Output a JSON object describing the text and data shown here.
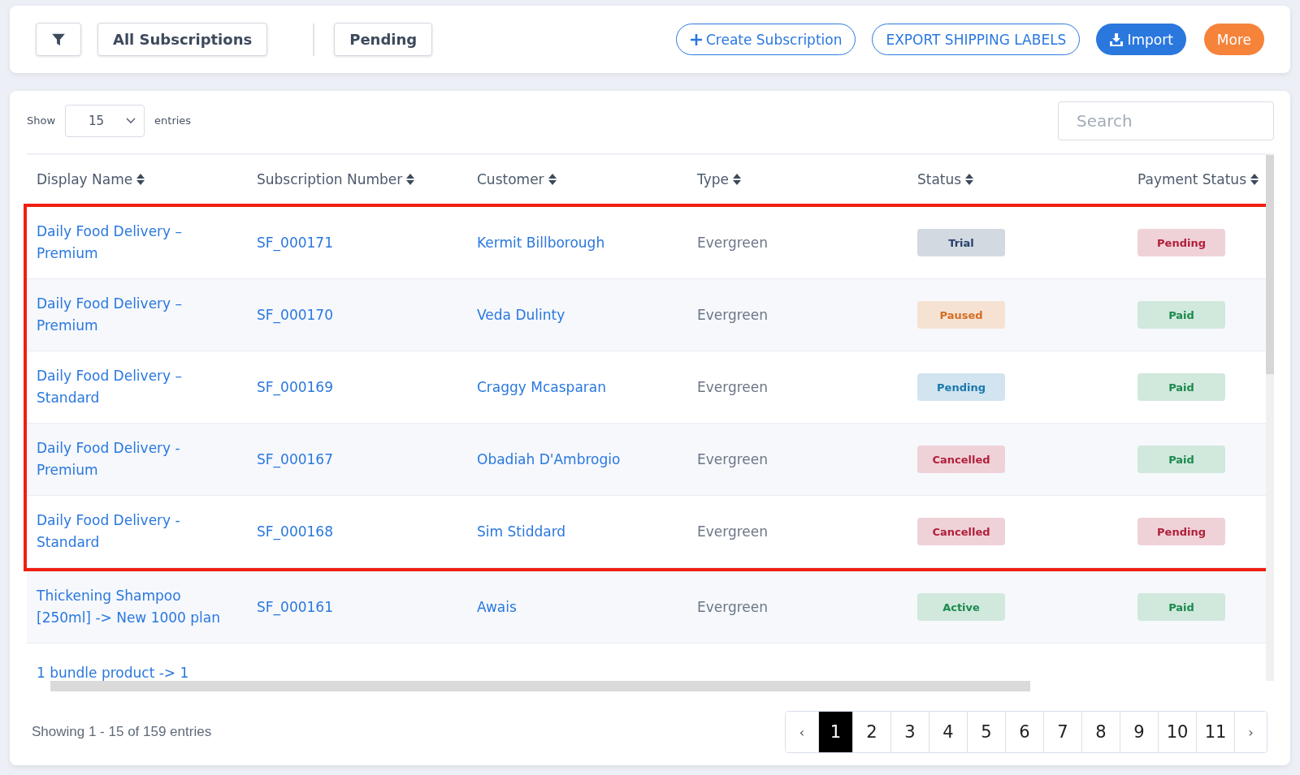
{
  "toolbar": {
    "filter_button": {
      "selected": false
    },
    "views": [
      {
        "label": "All Subscriptions",
        "selected": false
      },
      {
        "label": "Pending",
        "selected": false
      }
    ],
    "actions": [
      {
        "label": "Create Subscription",
        "kind": "outline-plus"
      },
      {
        "label": "EXPORT SHIPPING LABELS",
        "kind": "outline"
      },
      {
        "label": "Import",
        "kind": "primary-import"
      },
      {
        "label": "More",
        "kind": "accent"
      }
    ]
  },
  "table_controls": {
    "show_label": "Show",
    "page_size": "15",
    "entries_label": "entries",
    "search": {
      "placeholder": "Search"
    }
  },
  "table": {
    "columns": [
      "Display Name",
      "Subscription Number",
      "Customer",
      "Type",
      "Status",
      "Payment Status"
    ],
    "rows": [
      {
        "display_name": "Daily Food Delivery – Premium",
        "number": "SF_000171",
        "customer": "Kermit Billborough",
        "type": "Evergreen",
        "status": {
          "label": "Trial",
          "color": "#24416b"
        },
        "payment": {
          "label": "Pending",
          "color": "#b0203a"
        },
        "highlighted": true
      },
      {
        "display_name": "Daily Food Delivery – Premium",
        "number": "SF_000170",
        "customer": "Veda Dulinty",
        "type": "Evergreen",
        "status": {
          "label": "Paused",
          "color": "#d46d25"
        },
        "payment": {
          "label": "Paid",
          "color": "#1b8a4e"
        },
        "highlighted": true
      },
      {
        "display_name": "Daily Food Delivery – Standard",
        "number": "SF_000169",
        "customer": "Craggy Mcasparan",
        "type": "Evergreen",
        "status": {
          "label": "Pending",
          "color": "#1a78ad"
        },
        "payment": {
          "label": "Paid",
          "color": "#1b8a4e"
        },
        "highlighted": true
      },
      {
        "display_name": "Daily Food Delivery - Premium",
        "number": "SF_000167",
        "customer": "Obadiah D'Ambrogio",
        "type": "Evergreen",
        "status": {
          "label": "Cancelled",
          "color": "#b0203a"
        },
        "payment": {
          "label": "Paid",
          "color": "#1b8a4e"
        },
        "highlighted": true
      },
      {
        "display_name": "Daily Food Delivery - Standard",
        "number": "SF_000168",
        "customer": "Sim Stiddard",
        "type": "Evergreen",
        "status": {
          "label": "Cancelled",
          "color": "#b0203a"
        },
        "payment": {
          "label": "Pending",
          "color": "#b0203a"
        },
        "highlighted": true
      },
      {
        "display_name": "Thickening Shampoo [250ml] -> New 1000 plan",
        "number": "SF_000161",
        "customer": "Awais",
        "type": "Evergreen",
        "status": {
          "label": "Active",
          "color": "#1b8a4e"
        },
        "payment": {
          "label": "Paid",
          "color": "#1b8a4e"
        },
        "highlighted": false
      }
    ],
    "partial_row": {
      "display_name": "1 bundle product -> 1"
    }
  },
  "footer": {
    "summary": "Showing 1 - 15 of 159 entries",
    "pagination": {
      "prev": "‹",
      "next": "›",
      "pages": [
        {
          "label": "1",
          "selected": true
        },
        {
          "label": "2",
          "selected": false
        },
        {
          "label": "3",
          "selected": false
        },
        {
          "label": "4",
          "selected": false
        },
        {
          "label": "5",
          "selected": false
        },
        {
          "label": "6",
          "selected": false
        },
        {
          "label": "7",
          "selected": false
        },
        {
          "label": "8",
          "selected": false
        },
        {
          "label": "9",
          "selected": false
        },
        {
          "label": "10",
          "selected": false
        },
        {
          "label": "11",
          "selected": false
        }
      ]
    }
  }
}
